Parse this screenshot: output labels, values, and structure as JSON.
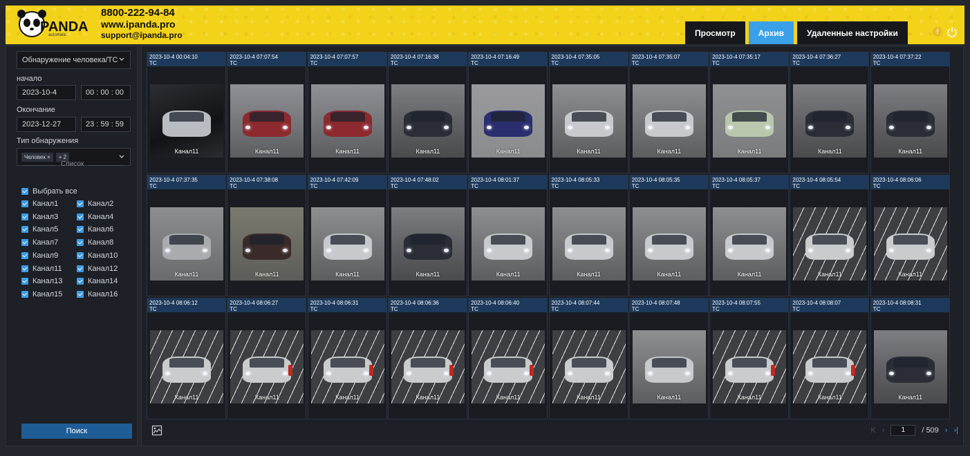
{
  "header": {
    "brand": "PANDA",
    "brand_sub": "automatic",
    "phone": "8800-222-94-84",
    "website": "www.ipanda.pro",
    "email": "support@ipanda.pro",
    "nav": [
      {
        "label": "Просмотр",
        "active": false
      },
      {
        "label": "Архив",
        "active": true
      },
      {
        "label": "Удаленные настройки",
        "active": false
      }
    ],
    "warning_icon": "warning-icon",
    "power_icon": "power-icon"
  },
  "filter": {
    "detection_mode": "Обнаружение человека/ТС",
    "start_label": "начало",
    "start_date": "2023-10-4",
    "start_time": "00 : 00 : 00",
    "end_label": "Окончание",
    "end_date": "2023-12-27",
    "end_time": "23 : 59 : 59",
    "detection_type_label": "Тип обнаружения",
    "detection_tag": "Человек",
    "detection_tag_more": "+ 2",
    "list_label": "Список",
    "select_all": "Выбрать все",
    "channels": [
      "Канал1",
      "Канал2",
      "Канал3",
      "Канал4",
      "Канал5",
      "Канал6",
      "Канал7",
      "Канал8",
      "Канал9",
      "Канал10",
      "Канал11",
      "Канал12",
      "Канал13",
      "Канал14",
      "Канал15",
      "Канал16"
    ],
    "search_button": "Поиск"
  },
  "results": [
    {
      "time": "2023-10-4 00:04:10",
      "type": "ТС",
      "channel": "Канал11",
      "scene": "night"
    },
    {
      "time": "2023-10-4 07:07:54",
      "type": "ТС",
      "channel": "Канал11",
      "scene": "red"
    },
    {
      "time": "2023-10-4 07:07:57",
      "type": "ТС",
      "channel": "Канал11",
      "scene": "red"
    },
    {
      "time": "2023-10-4 07:16:38",
      "type": "ТС",
      "channel": "Канал11",
      "scene": "dark"
    },
    {
      "time": "2023-10-4 07:16:49",
      "type": "ТС",
      "channel": "Канал11",
      "scene": "blue"
    },
    {
      "time": "2023-10-4 07:35:05",
      "type": "ТС",
      "channel": "Канал11",
      "scene": "silver"
    },
    {
      "time": "2023-10-4 07:35:07",
      "type": "ТС",
      "channel": "Канал11",
      "scene": "silver"
    },
    {
      "time": "2023-10-4 07:35:17",
      "type": "ТС",
      "channel": "Канал11",
      "scene": "green"
    },
    {
      "time": "2023-10-4 07:36:27",
      "type": "ТС",
      "channel": "Канал11",
      "scene": "dark"
    },
    {
      "time": "2023-10-4 07:37:22",
      "type": "ТС",
      "channel": "Канал11",
      "scene": "dark"
    },
    {
      "time": "2023-10-4 07:37:35",
      "type": "ТС",
      "channel": "Канал11",
      "scene": "grey"
    },
    {
      "time": "2023-10-4 07:38:08",
      "type": "ТС",
      "channel": "Канал11",
      "scene": "darkred"
    },
    {
      "time": "2023-10-4 07:42:09",
      "type": "ТС",
      "channel": "Канал11",
      "scene": "silver"
    },
    {
      "time": "2023-10-4 07:48:02",
      "type": "ТС",
      "channel": "Канал11",
      "scene": "dark"
    },
    {
      "time": "2023-10-4 08:01:37",
      "type": "ТС",
      "channel": "Канал11",
      "scene": "silver"
    },
    {
      "time": "2023-10-4 08:05:33",
      "type": "ТС",
      "channel": "Канал11",
      "scene": "silver"
    },
    {
      "time": "2023-10-4 08:05:35",
      "type": "ТС",
      "channel": "Канал11",
      "scene": "silver"
    },
    {
      "time": "2023-10-4 08:05:37",
      "type": "ТС",
      "channel": "Канал11",
      "scene": "silver"
    },
    {
      "time": "2023-10-4 08:05:54",
      "type": "ТС",
      "channel": "Канал11",
      "scene": "lot"
    },
    {
      "time": "2023-10-4 08:06:06",
      "type": "ТС",
      "channel": "Канал11",
      "scene": "lot"
    },
    {
      "time": "2023-10-4 08:06:12",
      "type": "ТС",
      "channel": "Канал11",
      "scene": "lot"
    },
    {
      "time": "2023-10-4 08:06:27",
      "type": "ТС",
      "channel": "Канал11",
      "scene": "lotp"
    },
    {
      "time": "2023-10-4 08:06:31",
      "type": "ТС",
      "channel": "Канал11",
      "scene": "lotp"
    },
    {
      "time": "2023-10-4 08:06:36",
      "type": "ТС",
      "channel": "Канал11",
      "scene": "lotp"
    },
    {
      "time": "2023-10-4 08:06:40",
      "type": "ТС",
      "channel": "Канал11",
      "scene": "lotp"
    },
    {
      "time": "2023-10-4 08:07:44",
      "type": "ТС",
      "channel": "Канал11",
      "scene": "lot"
    },
    {
      "time": "2023-10-4 08:07:48",
      "type": "ТС",
      "channel": "Канал11",
      "scene": "silver"
    },
    {
      "time": "2023-10-4 08:07:55",
      "type": "ТС",
      "channel": "Канал11",
      "scene": "lotp"
    },
    {
      "time": "2023-10-4 08:08:07",
      "type": "ТС",
      "channel": "Канал11",
      "scene": "lotp"
    },
    {
      "time": "2023-10-4 08:08:31",
      "type": "ТС",
      "channel": "Канал11",
      "scene": "dark"
    }
  ],
  "pagination": {
    "current_page": "1",
    "total": "/ 509",
    "first_icon": "first-page-icon",
    "prev_icon": "prev-page-icon",
    "next_icon": "next-page-icon",
    "last_icon": "last-page-icon"
  },
  "footer": {
    "image_icon": "image-export-icon"
  }
}
